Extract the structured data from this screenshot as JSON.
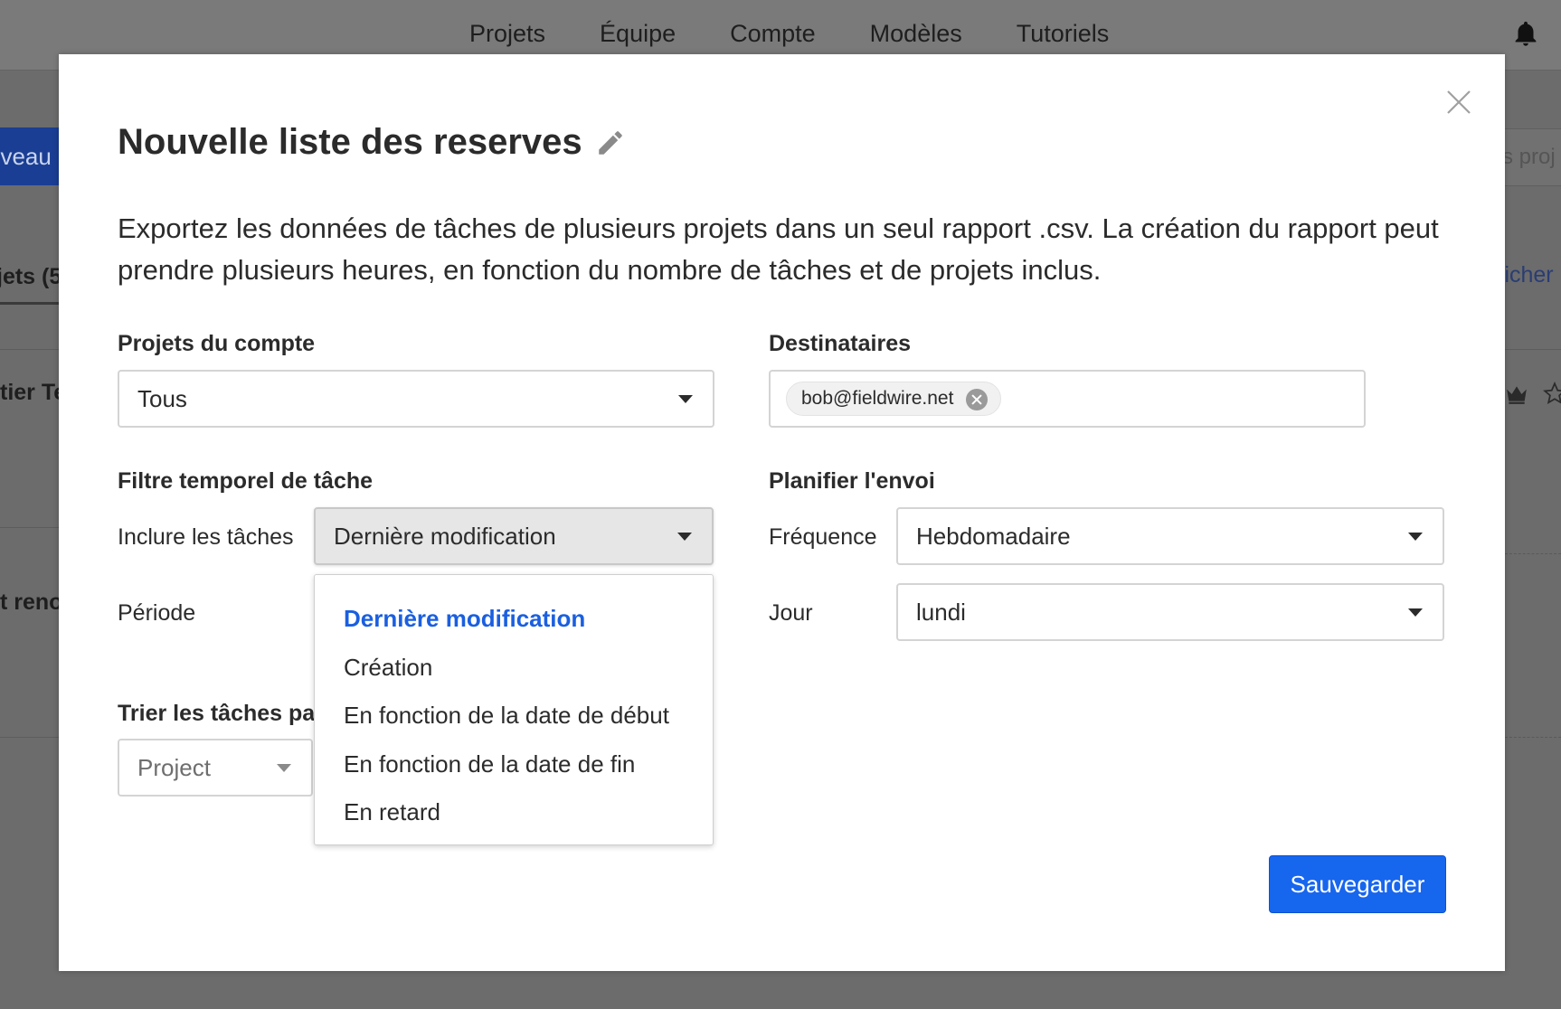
{
  "background": {
    "nav": [
      "Projets",
      "Équipe",
      "Compte",
      "Modèles",
      "Tutoriels"
    ],
    "new_button": "uveau",
    "projects_tab": "jets (5",
    "row1": "tier Te",
    "row2": "t reno",
    "search_placeholder": "s proj",
    "link": "fficher"
  },
  "modal": {
    "title": "Nouvelle liste des reserves",
    "description": "Exportez les données de tâches de plusieurs projets dans un seul rapport .csv. La création du rapport peut prendre plusieurs heures, en fonction du nombre de tâches et de projets inclus.",
    "projects": {
      "label": "Projets du compte",
      "value": "Tous"
    },
    "recipients": {
      "label": "Destinataires",
      "chips": [
        "bob@fieldwire.net"
      ]
    },
    "time_filter": {
      "label": "Filtre temporel de tâche",
      "include_label": "Inclure les tâches",
      "include_value": "Dernière modification",
      "period_label": "Période",
      "options": [
        "Dernière modification",
        "Création",
        "En fonction de la date de début",
        "En fonction de la date de fin",
        "En retard"
      ],
      "selected_option": "Dernière modification"
    },
    "schedule": {
      "label": "Planifier l'envoi",
      "frequency_label": "Fréquence",
      "frequency_value": "Hebdomadaire",
      "day_label": "Jour",
      "day_value": "lundi"
    },
    "sort": {
      "label": "Trier les tâches par",
      "value": "Project"
    },
    "save_label": "Sauvegarder"
  }
}
